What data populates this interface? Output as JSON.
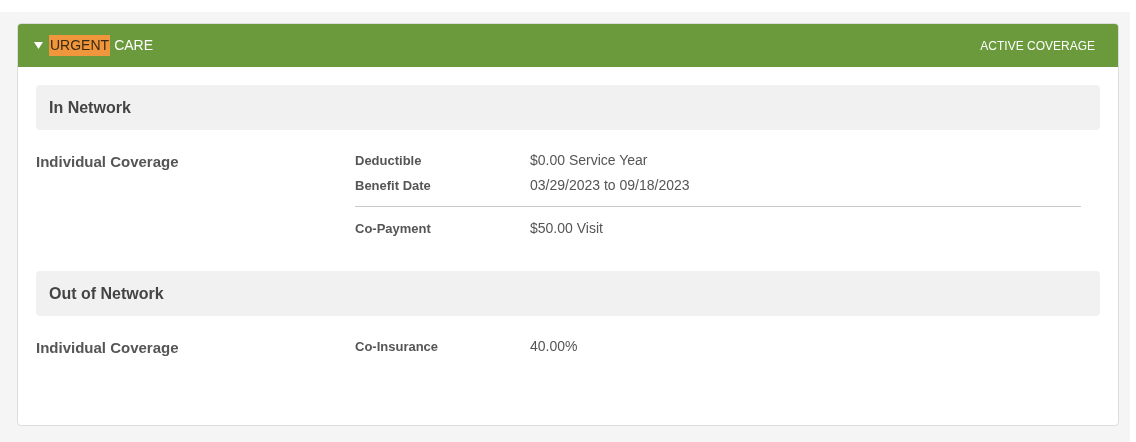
{
  "header": {
    "expanded": true,
    "title_parts": [
      {
        "text": "URGENT",
        "highlighted": true
      },
      {
        "text": "CARE",
        "highlighted": false
      }
    ],
    "status": "ACTIVE COVERAGE"
  },
  "sections": [
    {
      "title": "In Network",
      "coverage": "Individual Coverage",
      "groups": [
        {
          "rows": [
            {
              "label": "Deductible",
              "value": "$0.00 Service Year"
            },
            {
              "label": "Benefit Date",
              "value": "03/29/2023 to 09/18/2023"
            }
          ]
        },
        {
          "rows": [
            {
              "label": "Co-Payment",
              "value": "$50.00 Visit"
            }
          ]
        }
      ]
    },
    {
      "title": "Out of Network",
      "coverage": "Individual Coverage",
      "groups": [
        {
          "rows": [
            {
              "label": "Co-Insurance",
              "value": "40.00%"
            }
          ]
        }
      ]
    }
  ]
}
